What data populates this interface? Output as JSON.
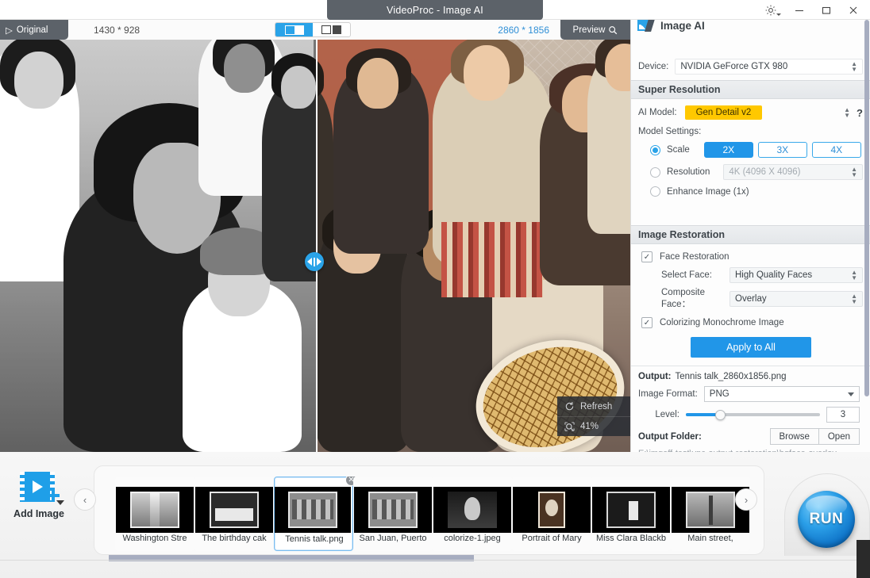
{
  "window": {
    "title": "VideoProc -  Image AI",
    "gear_icon": "gear-icon",
    "minimize": "–",
    "maximize": "□",
    "close": "✕"
  },
  "viewer": {
    "original_tab": "Original",
    "original_play_icon": "▷",
    "original_dimensions": "1430 * 928",
    "preview_dimensions": "2860 * 1856",
    "preview_tab": "Preview",
    "preview_zoom_icon": "magnifier-icon",
    "toggle_split_active": true,
    "toggle_split_label": "split-compare-view",
    "toggle_sidebyside_label": "side-by-side-view",
    "split_handle": "split-drag-handle",
    "overlay": {
      "refresh": "Refresh",
      "zoom_level": "41%"
    }
  },
  "panel": {
    "header": "Image AI",
    "device_label": "Device:",
    "device_value": "NVIDIA GeForce GTX 980",
    "super_resolution": {
      "section_title": "Super Resolution",
      "ai_model_label": "AI Model:",
      "ai_model_value": "Gen Detail v2",
      "help": "?",
      "model_settings_label": "Model Settings:",
      "scale_label": "Scale",
      "scale_selected": true,
      "scale_options": [
        "2X",
        "3X",
        "4X"
      ],
      "scale_active": "2X",
      "resolution_label": "Resolution",
      "resolution_selected": false,
      "resolution_value": "4K (4096 X 4096)",
      "enhance_label": "Enhance Image (1x)",
      "enhance_selected": false
    },
    "image_restoration": {
      "section_title": "Image Restoration",
      "face_restoration_label": "Face Restoration",
      "face_restoration_checked": true,
      "select_face_label": "Select Face:",
      "select_face_value": "High Quality Faces",
      "composite_face_label": "Composite Face：",
      "composite_face_value": "Overlay",
      "colorizing_label": "Colorizing Monochrome Image",
      "colorizing_checked": true
    },
    "apply_to_all": "Apply to All",
    "output": {
      "output_label": "Output:",
      "output_value": "Tennis talk_2860x1856.png",
      "image_format_label": "Image Format:",
      "image_format_value": "PNG",
      "level_label": "Level:",
      "level_value": "3",
      "output_folder_label": "Output Folder:",
      "browse": "Browse",
      "open": "Open",
      "path": "E:\\imgeff-test\\vpc-output-restoration\\hqface-overlay"
    }
  },
  "bottom": {
    "add_image_label": "Add Image",
    "add_image_icon": "add-image-icon",
    "nav_prev_icon": "chevron-left-icon",
    "nav_next_icon": "chevron-right-icon",
    "run_label": "RUN",
    "thumbnails": [
      {
        "name": "Washington Stre",
        "art": "street",
        "selected": false
      },
      {
        "name": "The birthday cak",
        "art": "table",
        "selected": false
      },
      {
        "name": "Tennis talk.png",
        "art": "group",
        "selected": true
      },
      {
        "name": "San Juan, Puerto",
        "art": "group",
        "selected": false
      },
      {
        "name": "colorize-1.jpeg",
        "art": "portrait",
        "selected": false
      },
      {
        "name": "Portrait of Mary ",
        "art": "sepia",
        "selected": false
      },
      {
        "name": "Miss Clara Blackb",
        "art": "clara",
        "selected": false
      },
      {
        "name": "Main street, ",
        "art": "main",
        "selected": false
      }
    ]
  },
  "colors": {
    "accent": "#2196e8",
    "accent_light": "#2aa3e8",
    "highlight_yellow": "#ffc800",
    "titlebar_tab": "#5c6269",
    "preview_dim_text": "#2f8fd6"
  }
}
